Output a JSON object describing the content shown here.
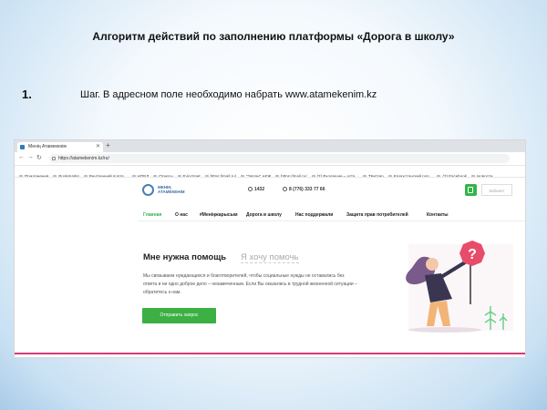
{
  "slide": {
    "title": "Алгоритм действий по заполнению платформы «Дорога в школу»",
    "step_number": "1.",
    "step_text": "Шаг. В адресном поле необходимо набрать www.atamekenim.kz"
  },
  "browser": {
    "tab_title": "Менің Атамекенім",
    "new_tab": "+",
    "url": "https://atamekenim.kz/ru/",
    "bookmarks": [
      "Приложения",
      "Bookmarks",
      "Внутренний порта...",
      "НОБД",
      "Отчеты",
      "E-kyzmet",
      "https://mail.ru/",
      "\"Эрлан\" АКЖ",
      "https://mail.ru/",
      "(2) Входящие – urza...",
      "Твиттер",
      "Казахстанский пор...",
      "(2) Facebook",
      "Новости"
    ]
  },
  "site": {
    "logo": "МЕНІҢ АТАМЕКЕНІМ",
    "phone_short": "1432",
    "phone_long": "8 (776) 333 77 66",
    "login": "Кабинет",
    "nav": [
      "Главная",
      "О нас",
      "#Меніңжарысым",
      "Дорога в школу",
      "Нас поддержали",
      "Защита прав потребителей",
      "Контакты"
    ],
    "hero_title": "Мне нужна помощь",
    "hero_alt": "Я хочу помочь",
    "hero_desc": "Мы связываем нуждающихся и благотворителей, чтобы социальные нужды не оставались без ответа и ни одно доброе дело – незамеченным. Если Вы оказались в трудной жизненной ситуации – обратитесь к нам.",
    "cta": "Отправить запрос"
  },
  "colors": {
    "accent_green": "#3cb043",
    "logo_blue": "#3b6ea5",
    "strip": "#d23a7a"
  }
}
